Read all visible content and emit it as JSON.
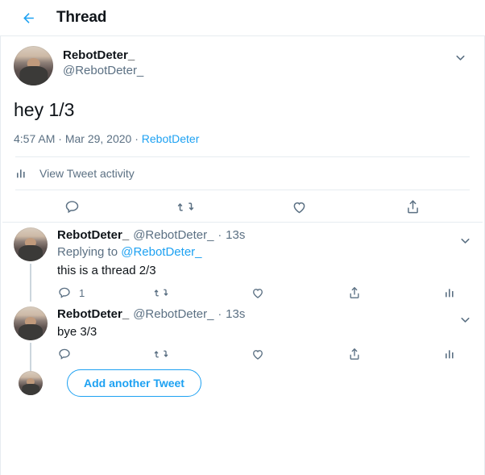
{
  "header": {
    "back_icon": "arrow-left-icon",
    "title": "Thread",
    "accent_color": "#1da1f2"
  },
  "main_tweet": {
    "display_name": "RebotDeter_",
    "handle": "@RebotDeter_",
    "text": "hey 1/3",
    "time": "4:57 AM",
    "separator": "·",
    "date": "Mar 29, 2020",
    "source": "RebotDeter",
    "caret_icon": "chevron-down-icon",
    "avatar": "avatar",
    "activity": {
      "icon": "analytics-bars-icon",
      "label": "View Tweet activity"
    },
    "actions": [
      {
        "name": "reply-icon",
        "count": ""
      },
      {
        "name": "retweet-icon",
        "count": ""
      },
      {
        "name": "like-icon",
        "count": ""
      },
      {
        "name": "share-icon",
        "count": ""
      }
    ]
  },
  "replies": [
    {
      "display_name": "RebotDeter_",
      "handle": "@RebotDeter_",
      "dot": "·",
      "time": "13s",
      "replying_to_prefix": "Replying to ",
      "replying_to_handle": "@RebotDeter_",
      "text": "this is a thread 2/3",
      "caret_icon": "chevron-down-icon",
      "actions": [
        {
          "name": "reply-icon",
          "count": "1"
        },
        {
          "name": "retweet-icon",
          "count": ""
        },
        {
          "name": "like-icon",
          "count": ""
        },
        {
          "name": "share-icon",
          "count": ""
        },
        {
          "name": "analytics-bars-icon",
          "count": ""
        }
      ]
    },
    {
      "display_name": "RebotDeter_",
      "handle": "@RebotDeter_",
      "dot": "·",
      "time": "13s",
      "replying_to_prefix": "",
      "replying_to_handle": "",
      "text": "bye 3/3",
      "caret_icon": "chevron-down-icon",
      "actions": [
        {
          "name": "reply-icon",
          "count": ""
        },
        {
          "name": "retweet-icon",
          "count": ""
        },
        {
          "name": "like-icon",
          "count": ""
        },
        {
          "name": "share-icon",
          "count": ""
        },
        {
          "name": "analytics-bars-icon",
          "count": ""
        }
      ]
    }
  ],
  "compose": {
    "add_button_label": "Add another Tweet"
  },
  "colors": {
    "accent": "#1da1f2",
    "text": "#0f1419",
    "muted": "#5b7083",
    "border": "#e6ecf0",
    "thread_line": "#ccd6dd"
  }
}
